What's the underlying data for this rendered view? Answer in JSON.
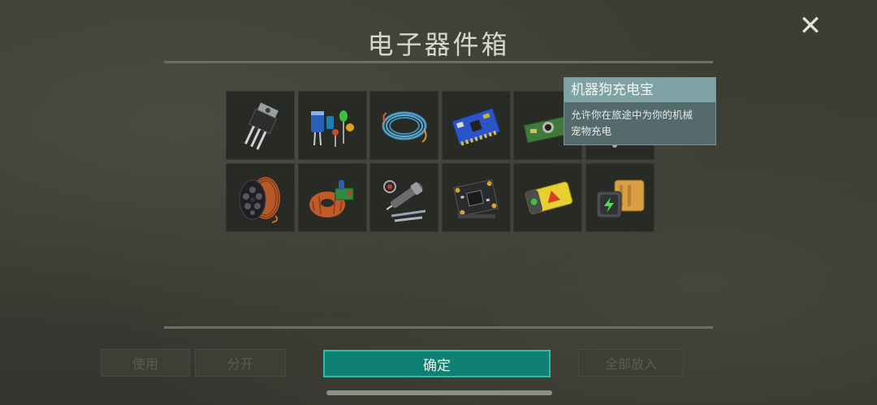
{
  "panel": {
    "title": "电子器件箱",
    "close_glyph": "✕"
  },
  "items": [
    {
      "name": "transistor-icon"
    },
    {
      "name": "capacitors-icon"
    },
    {
      "name": "wire-coil-icon"
    },
    {
      "name": "circuit-board-icon"
    },
    {
      "name": "camera-module-icon"
    },
    {
      "name": "motor-module-icon"
    },
    {
      "name": "copper-spool-icon"
    },
    {
      "name": "toroid-inductor-icon"
    },
    {
      "name": "soldering-tools-icon"
    },
    {
      "name": "flight-controller-icon"
    },
    {
      "name": "yellow-battery-icon"
    },
    {
      "name": "power-bank-icon"
    }
  ],
  "tooltip": {
    "title": "机器狗充电宝",
    "description_line1": "允许你在旅途中为你的机械",
    "description_line2": "宠物充电"
  },
  "background_buttons": {
    "use": "使用",
    "split": "分开",
    "put_all": "全部放入"
  },
  "confirm_label": "确定",
  "colors": {
    "accent": "#0e8174",
    "accent_border": "#33b9a6",
    "tooltip_header": "#7ea2a5"
  }
}
